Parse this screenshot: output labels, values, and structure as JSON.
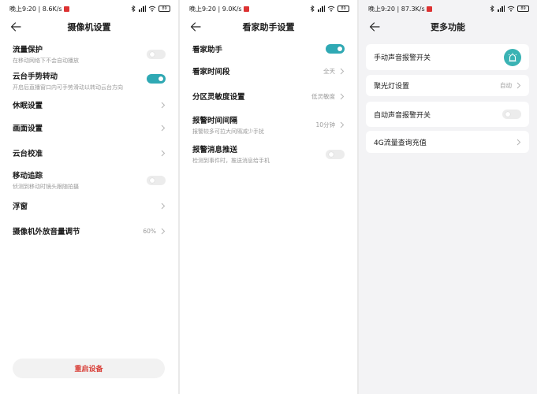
{
  "screen1": {
    "status": {
      "time": "晚上9:20 | 8.6K/s",
      "battery": "89"
    },
    "title": "摄像机设置",
    "items": [
      {
        "label": "流量保护",
        "sub": "在移动网络下不会自动播放",
        "toggle": false
      },
      {
        "label": "云台手势转动",
        "sub": "开启后直播窗口内可手势滑动以转动云台方向",
        "toggle": true
      },
      {
        "label": "休眠设置"
      },
      {
        "label": "画面设置"
      },
      {
        "label": "云台校准"
      },
      {
        "label": "移动追踪",
        "sub": "侦测到移动时镜头跟随拍摄",
        "toggle": false
      },
      {
        "label": "浮窗"
      },
      {
        "label": "摄像机外放音量调节",
        "value": "60%"
      }
    ],
    "restart_label": "重启设备"
  },
  "screen2": {
    "status": {
      "time": "晚上9:20 | 9.0K/s",
      "battery": "89"
    },
    "title": "看家助手设置",
    "items": [
      {
        "label": "看家助手",
        "toggle": true
      },
      {
        "label": "看家时间段",
        "value": "全天"
      },
      {
        "label": "分区灵敏度设置",
        "value": "低灵敏度"
      },
      {
        "label": "报警时间间隔",
        "sub": "报警较多可拉大间隔减少手扰",
        "value": "10分钟"
      },
      {
        "label": "报警消息推送",
        "sub": "检测到事件时，推送消息给手机",
        "toggle": false
      }
    ]
  },
  "screen3": {
    "status": {
      "time": "晚上9:20 | 87.3K/s",
      "battery": "89"
    },
    "title": "更多功能",
    "items": [
      {
        "label": "手动声音报警开关",
        "icon": "alarm-light-icon"
      },
      {
        "label": "聚光灯设置",
        "value": "自动"
      },
      {
        "label": "自动声音报警开关",
        "toggle": false
      },
      {
        "label": "4G流量查询充值"
      }
    ]
  },
  "colors": {
    "accent": "#2fa9b4",
    "danger": "#d9413a",
    "alarm_bg": "#3ab3b4"
  }
}
